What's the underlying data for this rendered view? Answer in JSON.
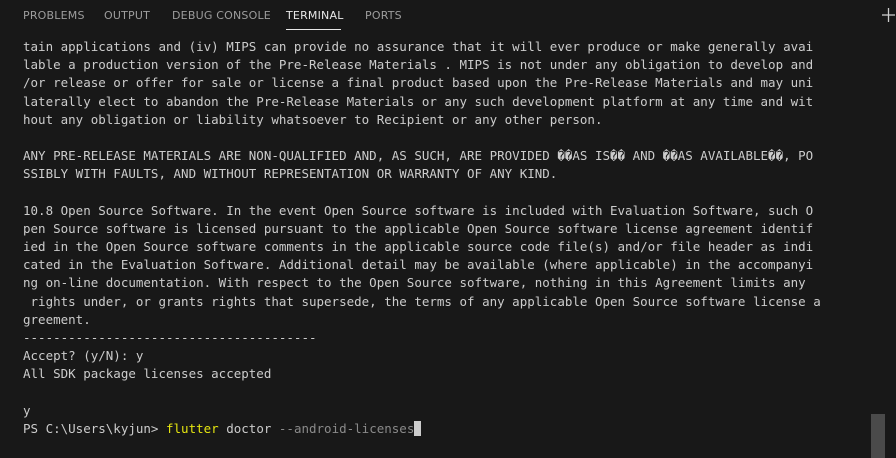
{
  "tabs": [
    {
      "label": "PROBLEMS"
    },
    {
      "label": "OUTPUT"
    },
    {
      "label": "DEBUG CONSOLE"
    },
    {
      "label": "TERMINAL",
      "active": true
    },
    {
      "label": "PORTS"
    }
  ],
  "toolbar": {
    "new_terminal_icon": "plus-icon"
  },
  "terminal": {
    "lines": [
      "tain applications and (iv) MIPS can provide no assurance that it will ever produce or make generally avai",
      "lable a production version of the Pre-Release Materials . MIPS is not under any obligation to develop and",
      "/or release or offer for sale or license a final product based upon the Pre-Release Materials and may uni",
      "laterally elect to abandon the Pre-Release Materials or any such development platform at any time and wit",
      "hout any obligation or liability whatsoever to Recipient or any other person.",
      "",
      "ANY PRE-RELEASE MATERIALS ARE NON-QUALIFIED AND, AS SUCH, ARE PROVIDED ��AS IS�� AND ��AS AVAILABLE��, PO",
      "SSIBLY WITH FAULTS, AND WITHOUT REPRESENTATION OR WARRANTY OF ANY KIND.",
      "",
      "10.8 Open Source Software. In the event Open Source software is included with Evaluation Software, such O",
      "pen Source software is licensed pursuant to the applicable Open Source software license agreement identif",
      "ied in the Open Source software comments in the applicable source code file(s) and/or file header as indi",
      "cated in the Evaluation Software. Additional detail may be available (where applicable) in the accompanyi",
      "ng on-line documentation. With respect to the Open Source software, nothing in this Agreement limits any",
      " rights under, or grants rights that supersede, the terms of any applicable Open Source software license a",
      "greement.",
      "---------------------------------------",
      "Accept? (y/N): y",
      "All SDK package licenses accepted",
      "",
      "y"
    ],
    "prompt": {
      "path": "PS C:\\Users\\kyjun> ",
      "command": "flutter",
      "subcommand": " doctor",
      "argument": " --android-licenses"
    }
  },
  "colors": {
    "background": "#181818",
    "text": "#cccccc",
    "command": "#e5e510",
    "argument": "#8a8a8a",
    "active_tab": "#e7e7e7",
    "inactive_tab": "#9d9d9d"
  }
}
